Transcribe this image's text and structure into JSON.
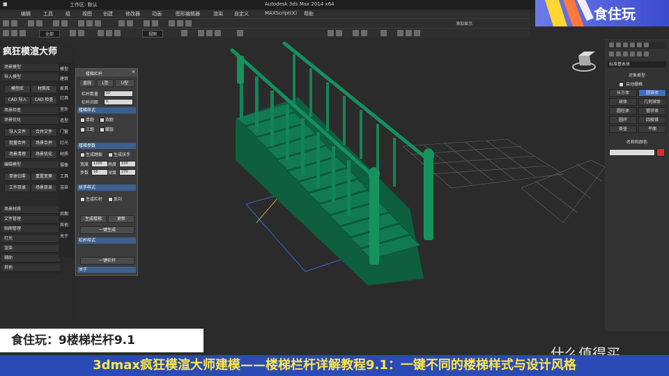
{
  "window": {
    "title": "Autodesk 3ds Max 2014 x64",
    "workspace": "工作区: 默认",
    "search_placeholder": "键入关键字"
  },
  "menu": [
    "编辑",
    "工具",
    "组",
    "视图",
    "创建",
    "修改器",
    "动画",
    "图形编辑器",
    "渲染",
    "自定义",
    "MAXScript(X)",
    "帮助"
  ],
  "toolbar": {
    "selection_set": "全部",
    "view_mode": "视图",
    "right_label": "添加显示"
  },
  "plugin": {
    "title": "疯狂模渲大师",
    "sections": [
      "场景模型",
      "导入模型",
      "场景检查",
      "场景优化",
      "编辑模型",
      "场景材质",
      "文件管理",
      "贴图管理",
      "灯光",
      "渲染",
      "辅助",
      "其他",
      "关于"
    ],
    "buttons": [
      [
        "模型库",
        "材质库"
      ],
      [
        "CAD 导入",
        "CAD 检查"
      ],
      [
        "导入文件",
        "合并文件"
      ],
      [
        "批量合并",
        "场景合并"
      ],
      [
        "场景清理",
        "场景优化"
      ],
      [
        "单体归零",
        "重置变换"
      ],
      [
        "工作目录",
        "场景目录"
      ]
    ],
    "side_labels": [
      "模型",
      "建筑",
      "家具",
      "灯具",
      "室外",
      "造型",
      "门窗",
      "灯光",
      "材质",
      "摄像",
      "工具",
      "渲染",
      "后期",
      "其他",
      "关于"
    ]
  },
  "stair_panel": {
    "title": "楼梯栏杆",
    "tabs": [
      "直线",
      "L型",
      "U型"
    ],
    "fields": [
      {
        "label": "栏杆数量",
        "value": "10"
      },
      {
        "label": "栏杆间距",
        "value": "0"
      }
    ],
    "sections": [
      "楼梯样式",
      "楼梯参数",
      "扶手样式",
      "栏杆样式",
      "一键生成"
    ],
    "style_options": [
      "单跑",
      "双跑",
      "三跑",
      "螺旋"
    ],
    "param_labels": [
      "宽度",
      "高度",
      "步数",
      "深度"
    ],
    "param_values": [
      "1200",
      "150",
      "18",
      "270"
    ],
    "checks": [
      "生成踏板",
      "生成扶手",
      "生成栏杆",
      "反向"
    ],
    "buttons": [
      "生成楼梯",
      "一键生成",
      "更新",
      "一键栏杆",
      "关于"
    ]
  },
  "right_panel": {
    "dropdown": "标准基本体",
    "header": "对象类型",
    "auto_grid": "自动栅格",
    "primitives": [
      "长方体",
      "圆锥体",
      "球体",
      "几何球体",
      "圆柱体",
      "管状体",
      "圆环",
      "四棱锥",
      "茶壶",
      "平面"
    ],
    "name_header": "名称和颜色",
    "color": "#d93030"
  },
  "brand": {
    "name": "食住玩"
  },
  "caption": {
    "line1": "食住玩：9楼梯栏杆9.1",
    "line2": "3dmax疯狂模渲大师建模——楼梯栏杆详解教程9.1：一键不同的楼梯样式与设计风格"
  },
  "watermark": "什么值得买",
  "colors": {
    "stair": "#127a52",
    "accent": "#3d5f8e",
    "caption_bg": "#2a4bb5",
    "caption_text": "#ffe74a"
  }
}
